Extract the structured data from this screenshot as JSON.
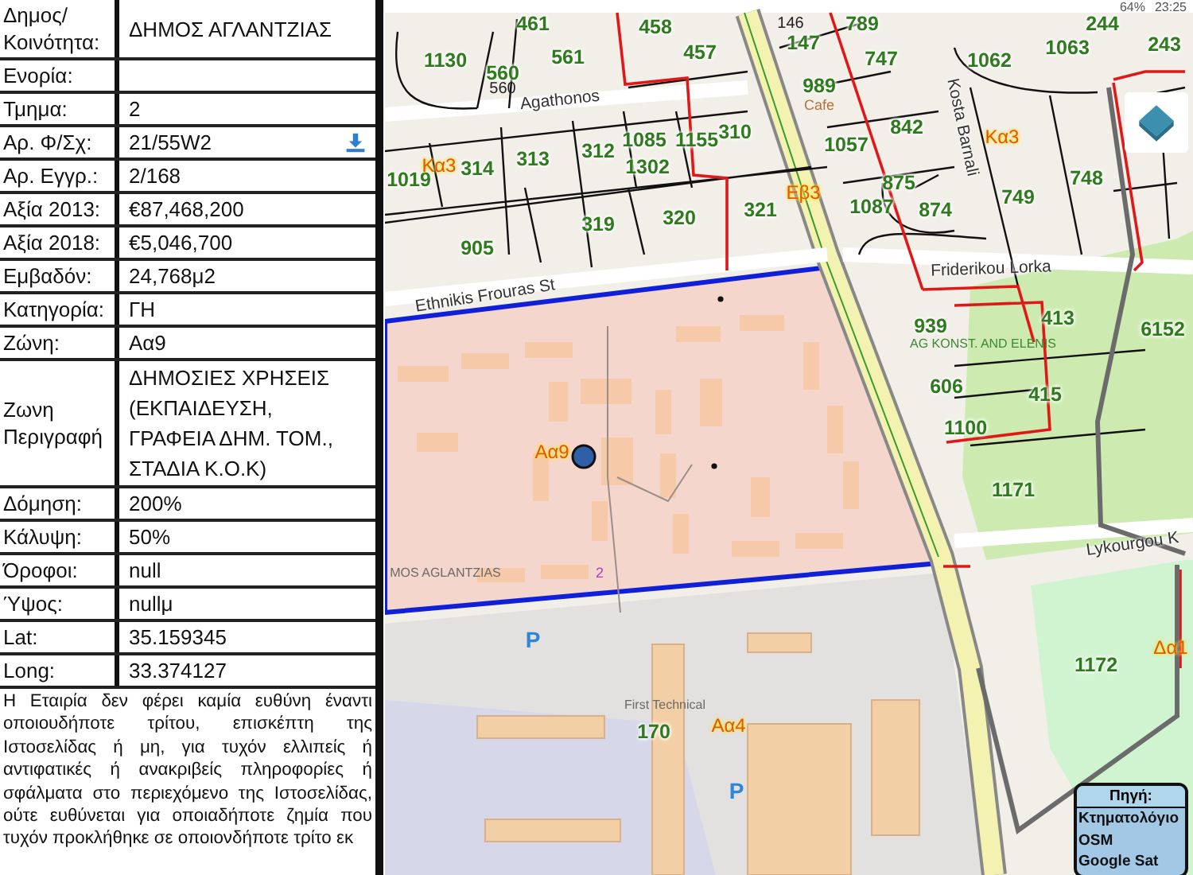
{
  "status_bar": {
    "battery": "64%",
    "time": "23:25"
  },
  "parcel_info": {
    "rows": [
      {
        "label": "Δημος/ Κοινότητα:",
        "value": "ΔΗΜΟΣ ΑΓΛΑΝΤΖΙΑΣ",
        "kind": "text"
      },
      {
        "label": "Ενορία:",
        "kind": "text"
      },
      {
        "label": "Τμημα:",
        "value": "2",
        "kind": "text"
      },
      {
        "label": "Αρ. Φ/Σχ:",
        "value": "21/55W2",
        "kind": "download"
      },
      {
        "label": "Αρ. Εγγρ.:",
        "value": "2/168",
        "kind": "text"
      },
      {
        "label": "Αξία 2013:",
        "value": "€87,468,200",
        "kind": "text"
      },
      {
        "label": "Αξία 2018:",
        "value": "€5,046,700",
        "kind": "text"
      },
      {
        "label": "Εμβαδόν:",
        "value": "24,768μ2",
        "kind": "text"
      },
      {
        "label": "Κατηγορία:",
        "value": "ΓΗ",
        "kind": "text"
      },
      {
        "label": "Ζώνη:",
        "value": "Αα9",
        "kind": "text"
      },
      {
        "label": "Ζωνη Περιγραφή",
        "value": "ΔΗΜΟΣΙΕΣ ΧΡΗΣΕΙΣ (ΕΚΠΑΙΔΕΥΣΗ, ΓΡΑΦΕΙΑ ΔΗΜ. ΤΟΜ., ΣΤΑΔΙΑ Κ.Ο.Κ)",
        "kind": "multiline"
      },
      {
        "label": "Δόμηση:",
        "value": "200%",
        "kind": "text"
      },
      {
        "label": "Κάλυψη:",
        "value": "50%",
        "kind": "text"
      },
      {
        "label": "Όροφοι:",
        "value": "null",
        "kind": "text"
      },
      {
        "label": "Ύψος:",
        "value": "nullμ",
        "kind": "text"
      },
      {
        "label": "Lat:",
        "value": "35.159345",
        "kind": "text"
      },
      {
        "label": "Long:",
        "value": "33.374127",
        "kind": "text"
      }
    ],
    "disclaimer": "Η Εταιρία δεν φέρει καμία ευθύνη έναντι οποιουδήποτε τρίτου, επισκέπτη της Ιστοσελίδας ή μη, για τυχόν ελλιπείς ή αντιφατικές ή ανακριβείς πληροφορίες ή σφάλματα στο περιεχόμενο της Ιστοσελίδας, ούτε ευθύνεται για οποιαδήποτε ζημία που τυχόν προκλήθηκε σε οποιονδήποτε τρίτο εκ"
  },
  "map": {
    "parcel_labels": [
      {
        "text": "461",
        "kind": "parcel"
      },
      {
        "text": "458",
        "kind": "parcel"
      },
      {
        "text": "146",
        "kind": "minor"
      },
      {
        "text": "789",
        "kind": "parcel"
      },
      {
        "text": "244",
        "kind": "parcel"
      },
      {
        "text": "1130",
        "kind": "parcel"
      },
      {
        "text": "561",
        "kind": "parcel"
      },
      {
        "text": "457",
        "kind": "parcel"
      },
      {
        "text": "147",
        "kind": "parcel"
      },
      {
        "text": "747",
        "kind": "parcel"
      },
      {
        "text": "1062",
        "kind": "parcel"
      },
      {
        "text": "1063",
        "kind": "parcel"
      },
      {
        "text": "243",
        "kind": "parcel"
      },
      {
        "text": "560",
        "kind": "parcel"
      },
      {
        "text": "560",
        "kind": "minor"
      },
      {
        "text": "989",
        "kind": "parcel"
      },
      {
        "text": "842",
        "kind": "parcel"
      },
      {
        "text": "310",
        "kind": "parcel"
      },
      {
        "text": "1085",
        "kind": "parcel"
      },
      {
        "text": "1155",
        "kind": "parcel"
      },
      {
        "text": "312",
        "kind": "parcel"
      },
      {
        "text": "1057",
        "kind": "parcel"
      },
      {
        "text": "313",
        "kind": "parcel"
      },
      {
        "text": "314",
        "kind": "parcel"
      },
      {
        "text": "1302",
        "kind": "parcel"
      },
      {
        "text": "1019",
        "kind": "parcel"
      },
      {
        "text": "875",
        "kind": "parcel"
      },
      {
        "text": "748",
        "kind": "parcel"
      },
      {
        "text": "319",
        "kind": "parcel"
      },
      {
        "text": "320",
        "kind": "parcel"
      },
      {
        "text": "321",
        "kind": "parcel"
      },
      {
        "text": "1087",
        "kind": "parcel"
      },
      {
        "text": "874",
        "kind": "parcel"
      },
      {
        "text": "749",
        "kind": "parcel"
      },
      {
        "text": "905",
        "kind": "parcel"
      },
      {
        "text": "413",
        "kind": "parcel"
      },
      {
        "text": "939",
        "kind": "parcel"
      },
      {
        "text": "6152",
        "kind": "parcel"
      },
      {
        "text": "606",
        "kind": "parcel"
      },
      {
        "text": "415",
        "kind": "parcel"
      },
      {
        "text": "1100",
        "kind": "parcel"
      },
      {
        "text": "1171",
        "kind": "parcel"
      },
      {
        "text": "1172",
        "kind": "parcel"
      },
      {
        "text": "170",
        "kind": "parcel"
      }
    ],
    "zone_labels": [
      {
        "text": "Κα3"
      },
      {
        "text": "Κα3"
      },
      {
        "text": "Εβ3"
      },
      {
        "text": "Αα9"
      },
      {
        "text": "Δα1"
      },
      {
        "text": "Αα4"
      }
    ],
    "street_labels": [
      {
        "text": "Agathonos"
      },
      {
        "text": "Kosta Barnali"
      },
      {
        "text": "Friderikou Lorka"
      },
      {
        "text": "Ethnikis Frouras St"
      },
      {
        "text": "Lykourgou K"
      }
    ],
    "place_labels": [
      {
        "text": "Cafe"
      },
      {
        "text": "AG KONST. AND ELENIS"
      },
      {
        "text": "First Technical"
      },
      {
        "text": "MOS AGLANTZIAS"
      },
      {
        "text": "2"
      }
    ],
    "parking_labels": [
      {
        "text": "P"
      },
      {
        "text": "P"
      }
    ],
    "source_menu": {
      "title": "Πηγή:",
      "options": [
        "Κτηματολόγιο",
        "OSM",
        "Google Sat"
      ]
    }
  }
}
